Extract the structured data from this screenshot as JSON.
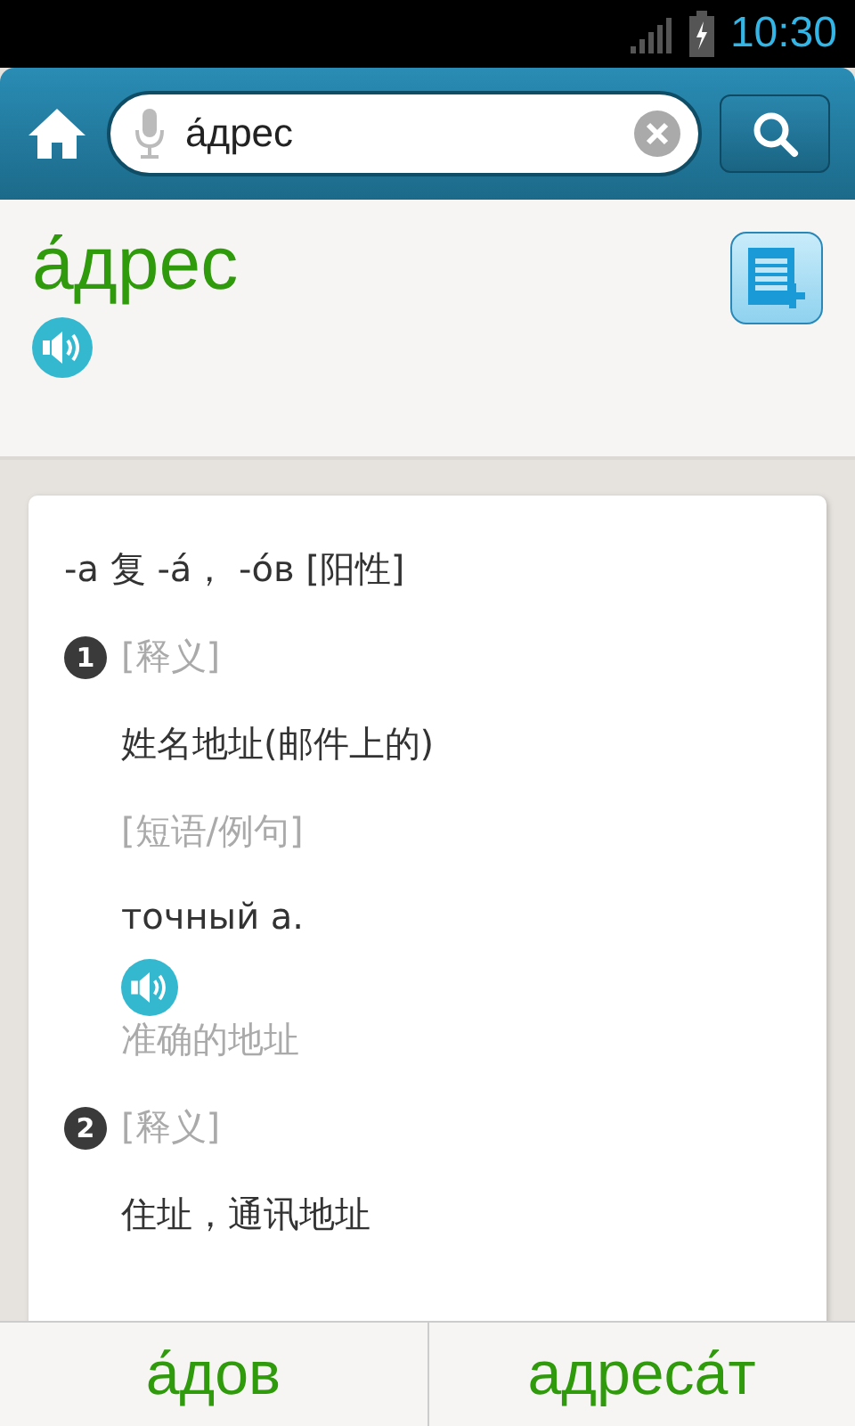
{
  "status_bar": {
    "time": "10:30"
  },
  "search": {
    "value": "а́дрес"
  },
  "entry": {
    "headword": "а́дрес"
  },
  "card": {
    "grammar": "-а 复 -а́， -о́в [阳性]",
    "senses": [
      {
        "number": "1",
        "label": "[释义]",
        "gloss": "姓名地址(邮件上的)",
        "examples_label": "[短语/例句]",
        "examples": [
          {
            "text": "точный а.",
            "translation": "准确的地址"
          }
        ]
      },
      {
        "number": "2",
        "label": "[释义]",
        "gloss": "住址，通讯地址"
      }
    ]
  },
  "nav": [
    {
      "label": "а́дов"
    },
    {
      "label": "адреса́т"
    }
  ]
}
